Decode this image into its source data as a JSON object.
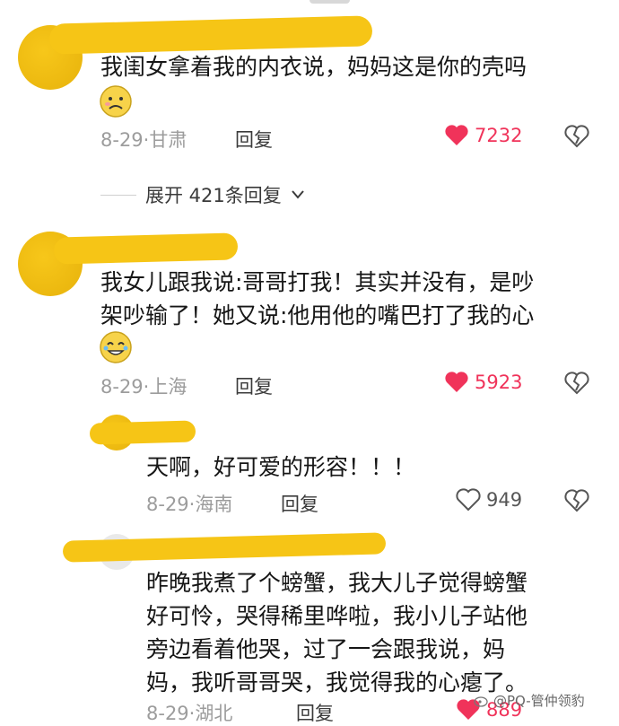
{
  "comments": [
    {
      "text": "我闺女拿着我的内衣说，妈妈这是你的壳吗",
      "date": "8-29",
      "location": "甘肃",
      "reply_label": "回复",
      "likes": "7232",
      "liked": true
    },
    {
      "text_line1": "我女儿跟我说:哥哥打我！其实并没有，是吵",
      "text_line2": "架吵输了！她又说:他用他的嘴巴打了我的心",
      "date": "8-29",
      "location": "上海",
      "reply_label": "回复",
      "likes": "5923",
      "liked": true
    },
    {
      "text": "天啊，好可爱的形容！！！",
      "date": "8-29",
      "location": "海南",
      "reply_label": "回复",
      "likes": "949",
      "liked": false
    },
    {
      "text_line1": "昨晚我煮了个螃蟹，我大儿子觉得螃蟹",
      "text_line2": "好可怜，哭得稀里哗啦，我小儿子站他",
      "text_line3": "旁边看着他哭，过了一会跟我说，妈",
      "text_line4": "妈，我听哥哥哭，我觉得我的心瘪了。",
      "date": "8-29",
      "location": "湖北",
      "reply_label": "回复",
      "likes": "889",
      "liked": true
    }
  ],
  "expand_replies": {
    "label": "展开 421条回复"
  },
  "watermark": {
    "text": "@PQ-管仲领豹"
  },
  "colors": {
    "like_red": "#f0335a",
    "highlight_yellow": "#f6c516"
  },
  "icons": [
    "heart-icon",
    "broken-heart-icon",
    "chevron-down-icon",
    "emoji-icon",
    "weibo-icon"
  ]
}
